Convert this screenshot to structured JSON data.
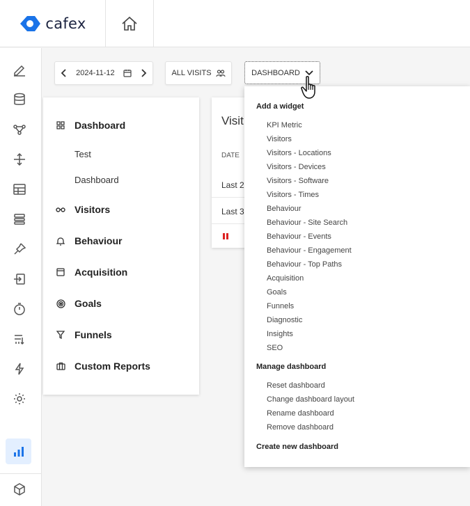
{
  "brand": {
    "logo_text": "cafex",
    "logo_color": "#1a73e8"
  },
  "toolbar": {
    "date_value": "2024-11-12",
    "visits_label": "ALL VISITS",
    "dashboard_label": "DASHBOARD"
  },
  "rail": {
    "items": [
      "pencil-icon",
      "database-icon",
      "workflow-icon",
      "move-icon",
      "table-icon",
      "list-icon",
      "pin-icon",
      "import-icon",
      "timer-icon",
      "sort-icon",
      "lightning-icon",
      "settings-icon",
      "analytics-icon",
      "box-icon"
    ],
    "active": "analytics-icon",
    "active_color": "#1a73e8"
  },
  "menu": {
    "dashboard": "Dashboard",
    "sub_test": "Test",
    "sub_dashboard": "Dashboard",
    "visitors": "Visitors",
    "behaviour": "Behaviour",
    "acquisition": "Acquisition",
    "goals": "Goals",
    "funnels": "Funnels",
    "custom_reports": "Custom Reports"
  },
  "visits_card": {
    "title": "Visit",
    "date_header": "DATE",
    "row1": "Last 2",
    "row2": "Last 3"
  },
  "dropdown": {
    "add_widget_heading": "Add a widget",
    "widgets": [
      "KPI Metric",
      "Visitors",
      "Visitors - Locations",
      "Visitors - Devices",
      "Visitors - Software",
      "Visitors - Times",
      "Behaviour",
      "Behaviour - Site Search",
      "Behaviour - Events",
      "Behaviour - Engagement",
      "Behaviour - Top Paths",
      "Acquisition",
      "Goals",
      "Funnels",
      "Diagnostic",
      "Insights",
      "SEO"
    ],
    "manage_heading": "Manage dashboard",
    "manage_items": [
      "Reset dashboard",
      "Change dashboard layout",
      "Rename dashboard",
      "Remove dashboard"
    ],
    "create_label": "Create new dashboard"
  }
}
